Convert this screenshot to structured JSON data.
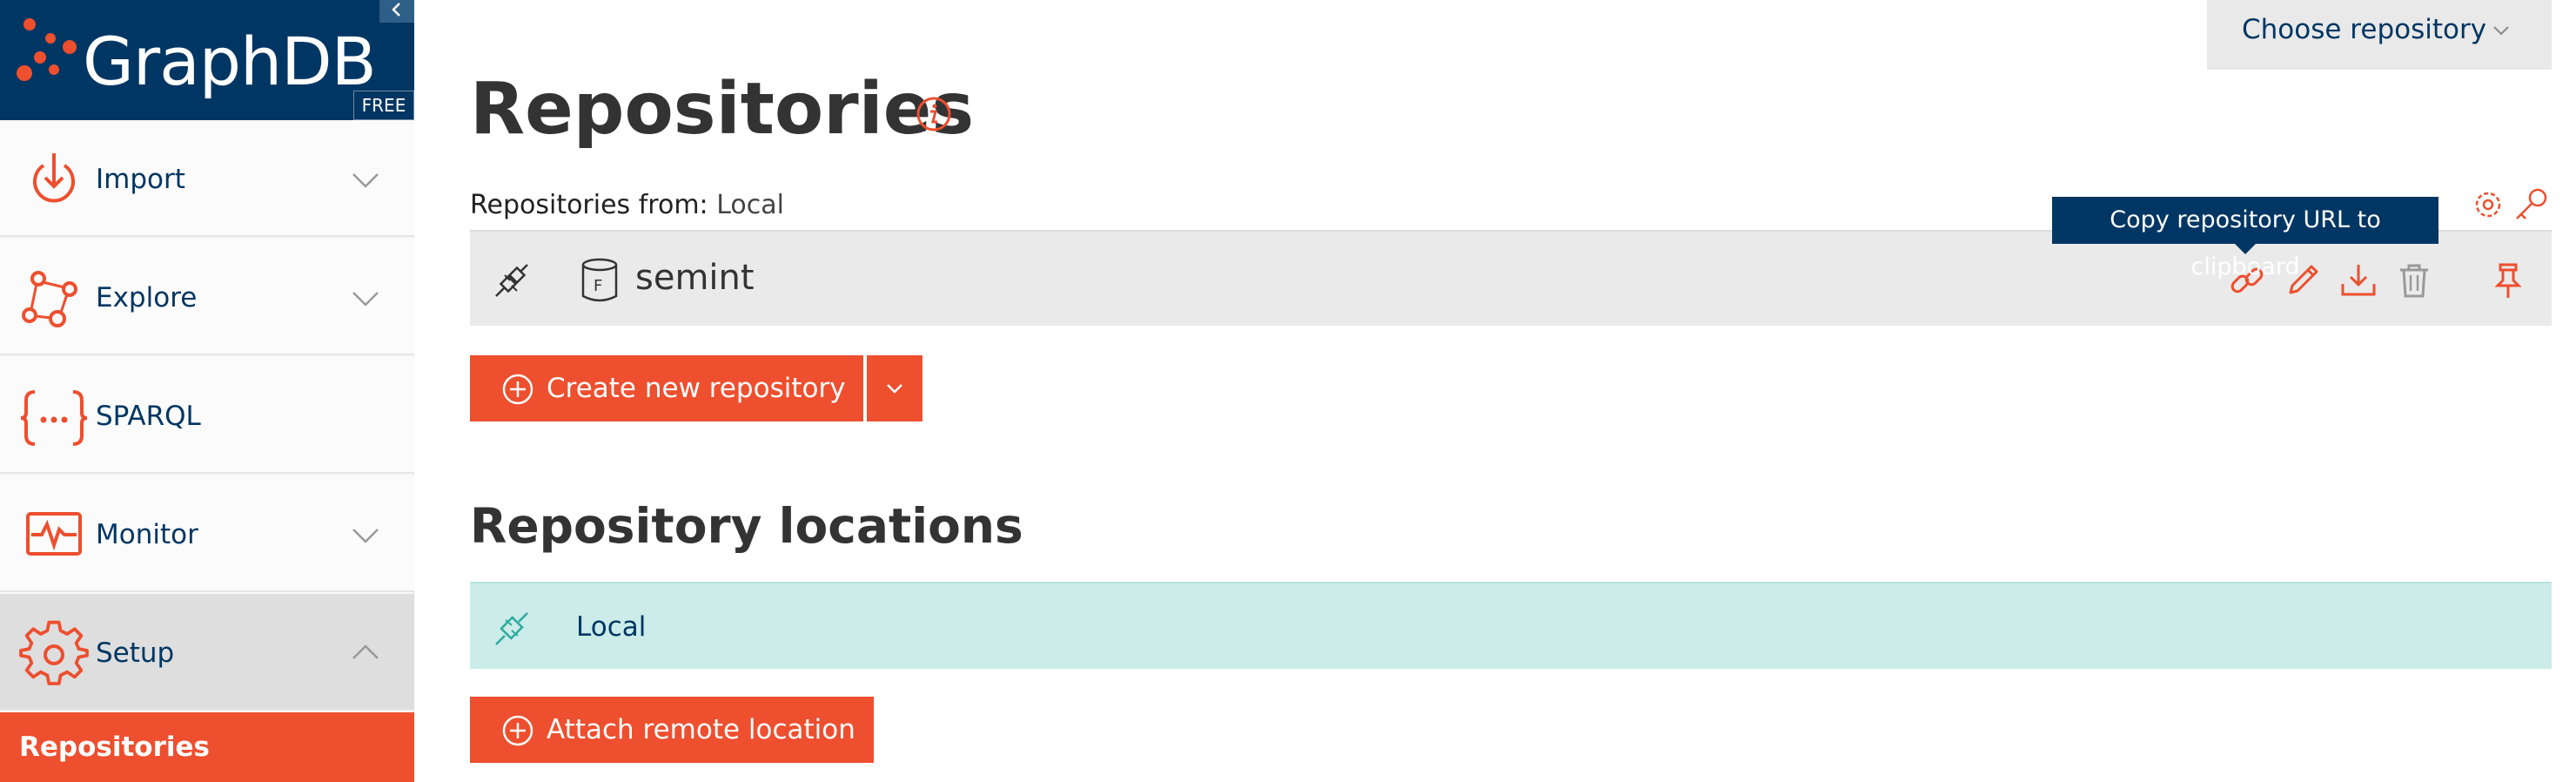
{
  "brand": {
    "name": "GraphDB",
    "edition": "FREE",
    "primary_color": "#003663",
    "accent_color": "#ed4f2f"
  },
  "sidebar": {
    "collapse_icon": "chevron-left-icon",
    "items": [
      {
        "label": "Import",
        "icon": "import-icon",
        "expanded": false
      },
      {
        "label": "Explore",
        "icon": "explore-icon",
        "expanded": false
      },
      {
        "label": "SPARQL",
        "icon": "sparql-icon"
      },
      {
        "label": "Monitor",
        "icon": "monitor-icon",
        "expanded": false
      },
      {
        "label": "Setup",
        "icon": "gear-icon",
        "expanded": true
      }
    ],
    "active_subitem": "Repositories"
  },
  "header": {
    "choose_repository": "Choose repository"
  },
  "main": {
    "title": "Repositories",
    "repos_from_label": "Repositories from:",
    "repos_from_value": "Local",
    "tooltip": "Copy repository URL to clipboard",
    "repositories": [
      {
        "name": "semint",
        "type_letter": "F"
      }
    ],
    "create_button": "Create new repository",
    "locations_title": "Repository locations",
    "locations": [
      {
        "name": "Local"
      }
    ],
    "attach_button": "Attach remote location"
  }
}
